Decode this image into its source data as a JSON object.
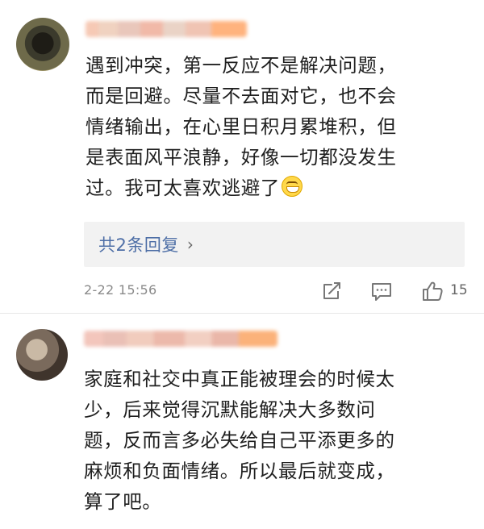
{
  "comments": [
    {
      "avatar_icon": "user-avatar",
      "username_blurred": true,
      "text": "遇到冲突，第一反应不是解决问题，\n而是回避。尽量不去面对它，也不会\n情绪输出，在心里日积月累堆积，但\n是表面风平浪静，好像一切都没发生\n过。我可太喜欢逃避了",
      "emoji": "grinning-emoji",
      "replies_label": "共2条回复",
      "timestamp": "2-22 15:56",
      "like_count": "15"
    },
    {
      "avatar_icon": "user-avatar",
      "username_blurred": true,
      "text": "家庭和社交中真正能被理会的时候太\n少，后来觉得沉默能解决大多数问\n题，反而言多必失给自己平添更多的\n麻烦和负面情绪。所以最后就变成，\n算了吧。"
    }
  ],
  "colors": {
    "link": "#4d6ea6",
    "meta": "#8a8a8a",
    "reply_bg": "#f2f2f2"
  }
}
